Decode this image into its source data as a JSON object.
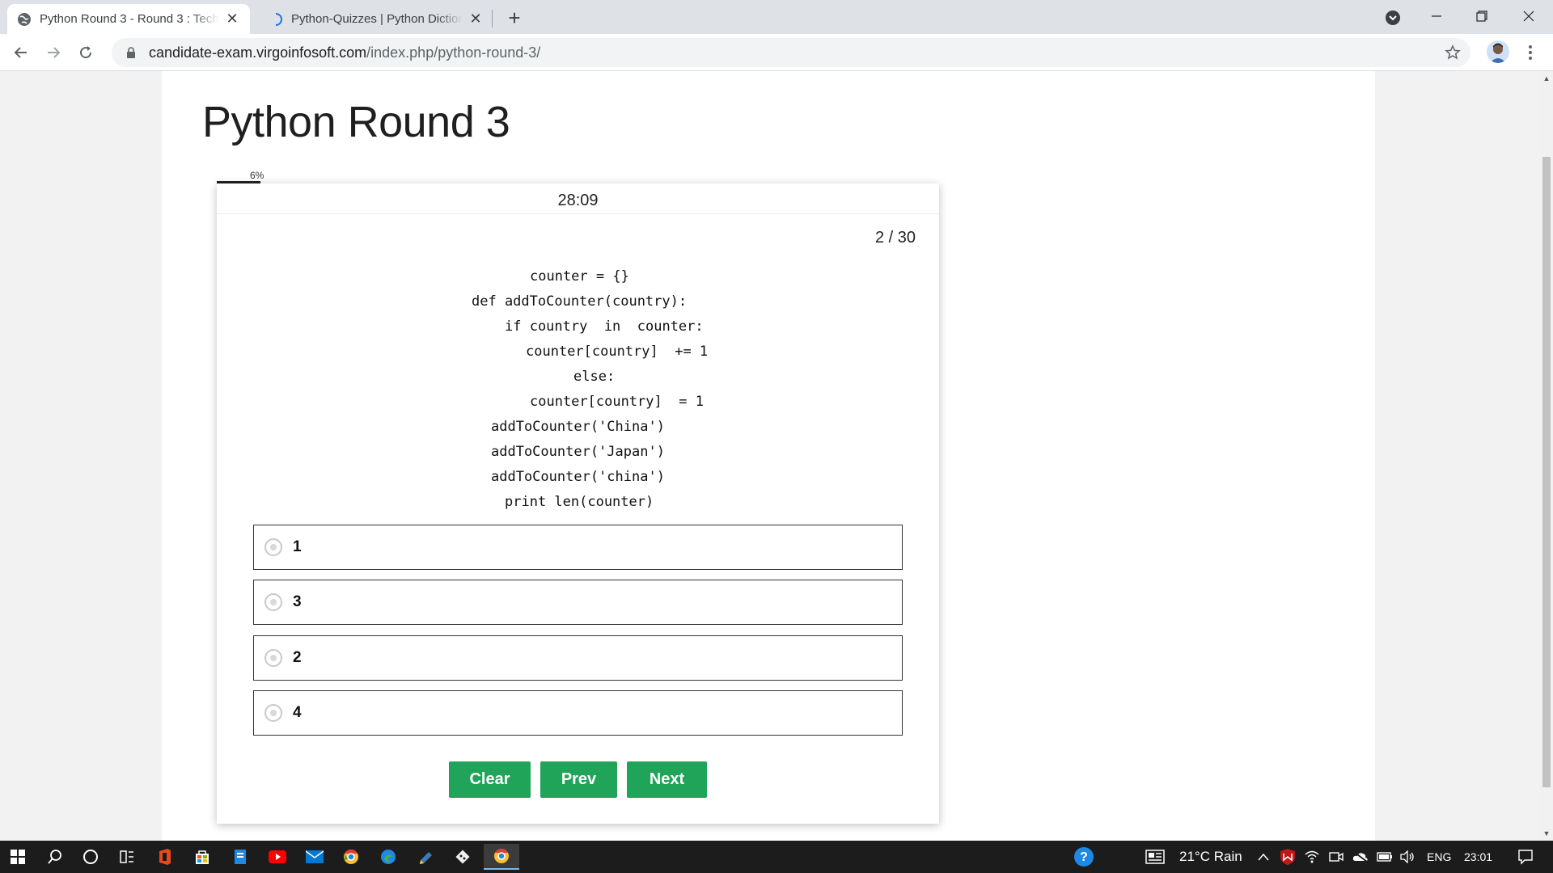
{
  "browser": {
    "tabs": [
      {
        "title": "Python Round 3 - Round 3 : Technical",
        "active": true
      },
      {
        "title": "Python-Quizzes | Python Dictionary",
        "active": false
      }
    ],
    "url_host": "candidate-exam.virgoinfosoft.com",
    "url_path": "/index.php/python-round-3/"
  },
  "page": {
    "title": "Python Round 3"
  },
  "quiz": {
    "progress_label": "6%",
    "progress_fraction": 0.06,
    "timer": "28:09",
    "question_counter": "2 / 30",
    "code_lines": [
      "counter = {}",
      "def addToCounter(country):",
      "if country  in  counter:",
      "counter[country]  += 1",
      "else:",
      "counter[country]  = 1",
      "addToCounter('China')",
      "addToCounter('Japan')",
      "addToCounter('china')",
      "print len(counter)"
    ],
    "options": [
      "1",
      "3",
      "2",
      "4"
    ],
    "buttons": {
      "clear": "Clear",
      "prev": "Prev",
      "next": "Next"
    },
    "button_color": "#1fa45a"
  },
  "taskbar": {
    "weather": "21°C  Rain",
    "language": "ENG",
    "time": "23:01"
  }
}
